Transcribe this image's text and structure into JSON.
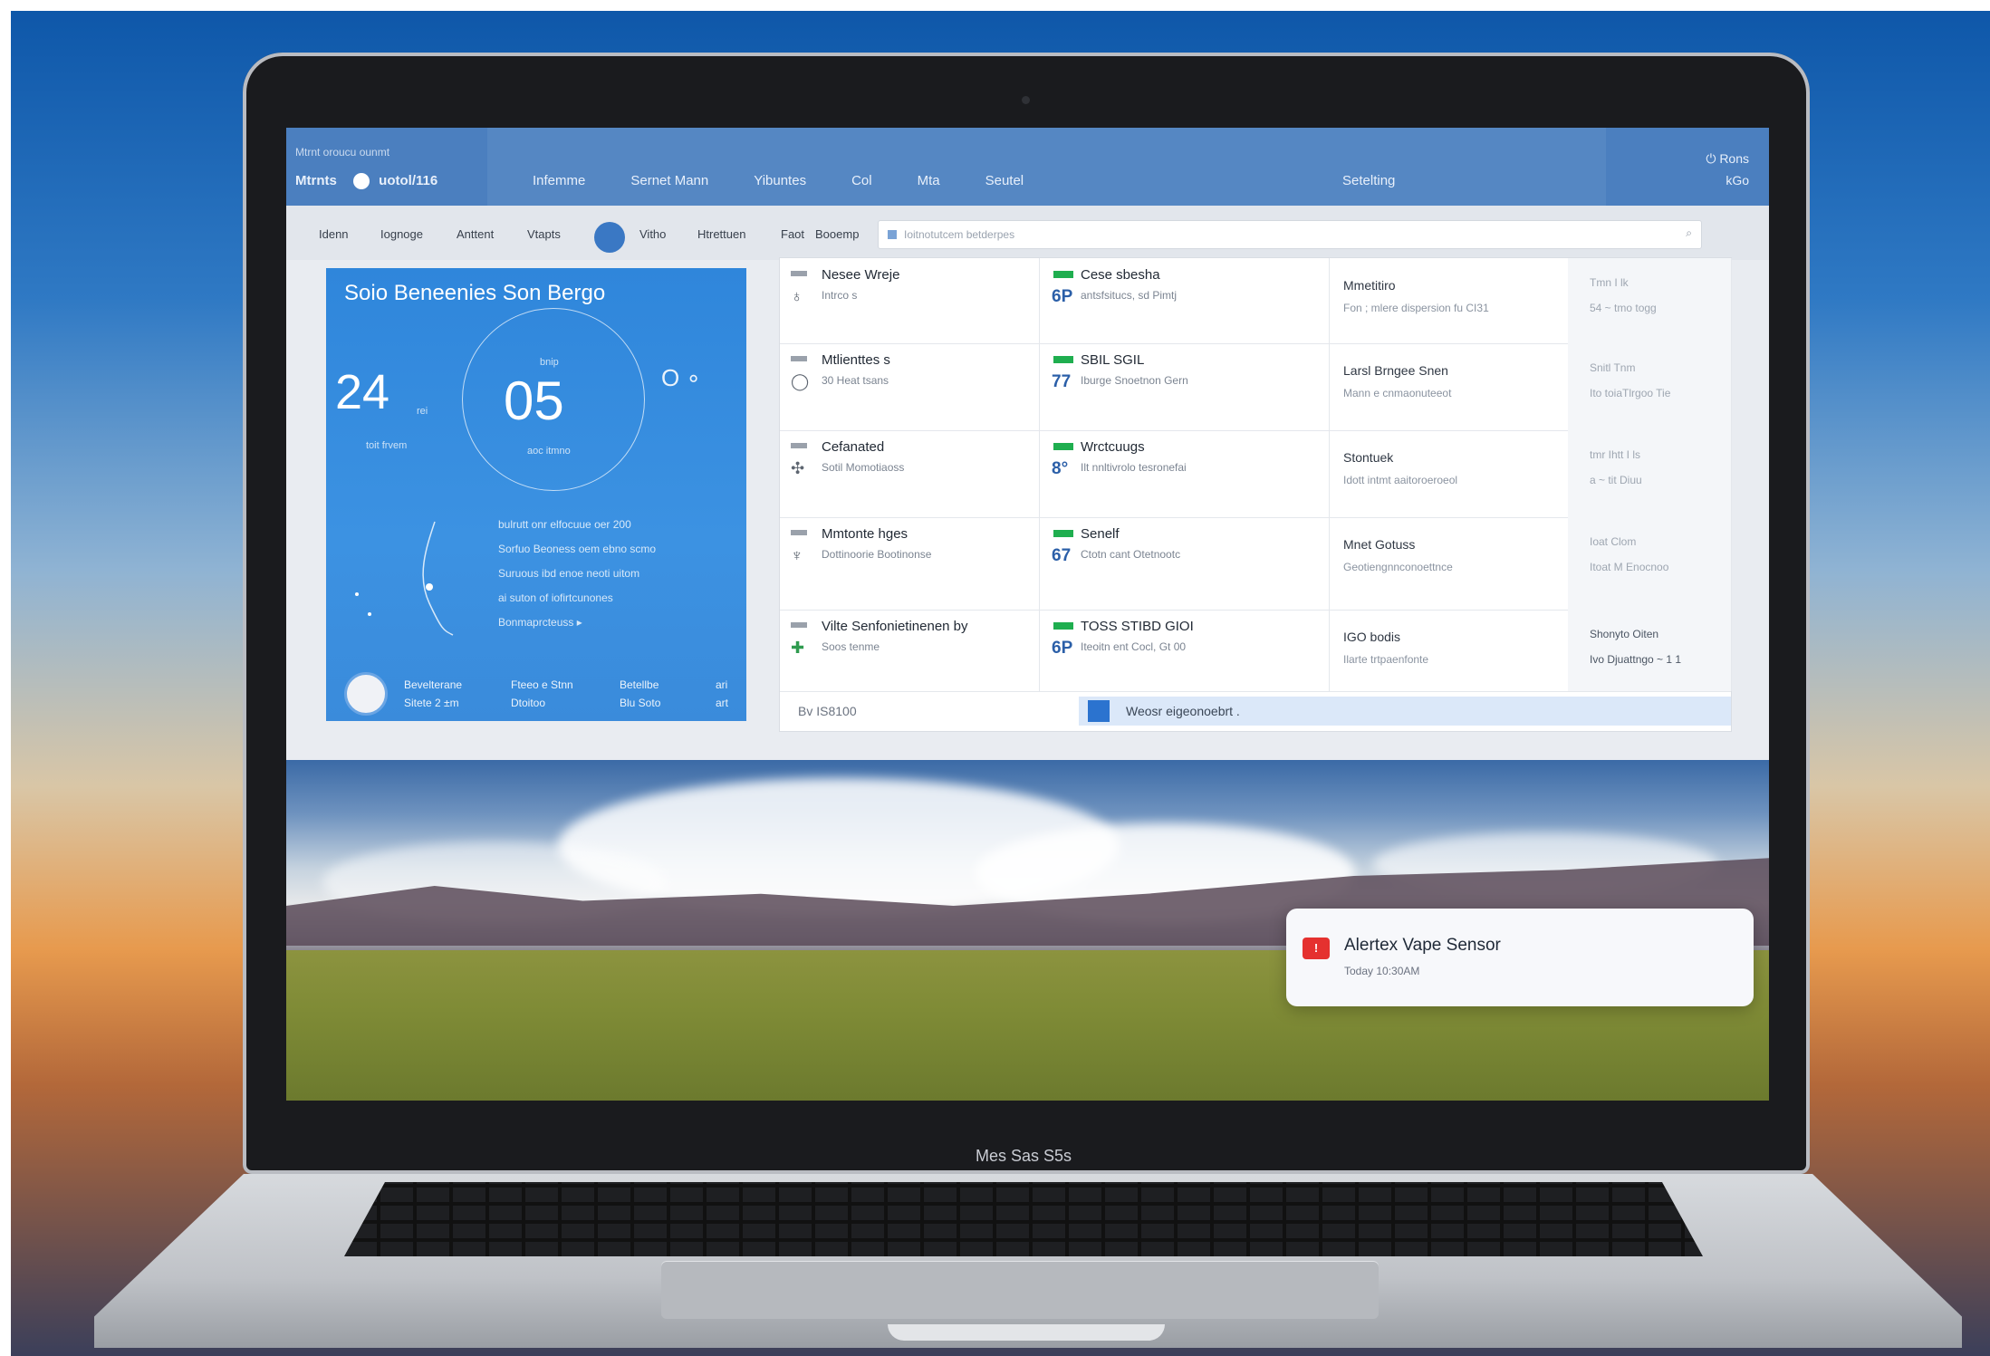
{
  "device": {
    "chin_label": "Mes Sas S5s"
  },
  "header": {
    "brand_top": "Mtrnt  oroucu  ounmt",
    "brand": "Mtrnts",
    "brand_item": "uotol/116",
    "nav": [
      "Infemme",
      "Sernet Mann",
      "Yibuntes",
      "Col",
      "Mta",
      "Seutel"
    ],
    "center": "Setelting",
    "right_top": "Rons",
    "right_bottom": "kGo"
  },
  "toolbar": {
    "links": [
      "Idenn",
      "Iognoge",
      "Anttent",
      "Vtapts",
      "Vitho",
      "Htrettuen",
      "Faot",
      "Booemp"
    ],
    "search_placeholder": "Ioitnotutcem  betderpes",
    "search_icon": "search-icon"
  },
  "weather": {
    "title": "Soio Beneenies Son Bergo",
    "left_value": "24",
    "left_unit": "rei",
    "left_sub": "toit frvem",
    "center_value": "05",
    "center_top": "bnip",
    "center_bottom": "aoc itmno",
    "lines": [
      "bulrutt onr elfocuue oer 200",
      "Sorfuo Beoness oem ebno scmo",
      "Suruous ibd enoe neoti uitom",
      "ai suton of iofirtcunones",
      "Bonmaprcteuss ▸"
    ],
    "footer": [
      {
        "top": "Bevelterane",
        "bottom": "Sitete  2 ±m"
      },
      {
        "top": "Fteeo e Stnn",
        "bottom": "Dtoitoo"
      },
      {
        "top": "Betellbe",
        "bottom": "Blu  Soto"
      },
      {
        "top": "ari",
        "bottom": "art"
      }
    ]
  },
  "grid": {
    "rows": [
      {
        "c1_title": "Nesee Wreje",
        "c1_sub": "Intrco s",
        "c2_title": "Cese sbesha",
        "c2_num": "6P",
        "c2_sub": "antsfsitucs, sd Pimtj",
        "c3_title": "Mmetitiro",
        "c3_sub": "Fon ; mlere dispersion fu CI31",
        "c4_title": "Tmn   I  lk",
        "c4_sub": "54 ~ tmo togg"
      },
      {
        "c1_title": "Mtlienttes s",
        "c1_sub": "30 Heat tsans",
        "c2_title": "SBIL SGIL",
        "c2_num": "77",
        "c2_sub": "Iburge Snoetnon Gern",
        "c3_title": "Larsl Brngee Snen",
        "c3_sub": "Mann e cnmaonuteeot",
        "c4_title": "Snitl Tnm",
        "c4_sub": "Ito toiaTlrgoo  Tie"
      },
      {
        "c1_title": "Cefanated",
        "c1_sub": "Sotil Momotiaoss",
        "c2_title": "Wrctcuugs",
        "c2_num": "8°",
        "c2_sub": "Ilt nnltivrolo tesronefai",
        "c3_title": "Stontuek",
        "c3_sub": "Idott intmt aaitoroeroeol",
        "c4_title": "tmr Ihtt    I  ls",
        "c4_sub": "a ~ tit Diuu"
      },
      {
        "c1_title": "Mmtonte hges",
        "c1_sub": "Dottinoorie Bootinonse",
        "c2_title": "Senelf",
        "c2_num": "67",
        "c2_sub": "Ctotn cant Otetnootc",
        "c3_title": "Mnet Gotuss",
        "c3_sub": "Geotiengnnconoettnce",
        "c4_title": "Ioat Clom",
        "c4_sub": "Itoat M Enocnoo"
      },
      {
        "c1_title": "Vilte Senfonietinenen by",
        "c1_sub": "Soos tenme",
        "c2_title": "TOSS STIBD GIOI",
        "c2_num": "6P",
        "c2_sub": "Iteoitn ent Cocl, Gt 00",
        "c3_title": "IGO bodis",
        "c3_sub": "Ilarte trtpaenfonte",
        "c4_title": "Shonyto Oiten",
        "c4_sub": "Ivo Djuattngo ~ 1 1"
      }
    ],
    "footer_left": "Bv  IS8100",
    "footer_right": "Weosr eigeonoebrt ."
  },
  "notification": {
    "title": "Alertex Vape Sensor",
    "time": "Today 10:30AM",
    "icon_label": "!"
  }
}
